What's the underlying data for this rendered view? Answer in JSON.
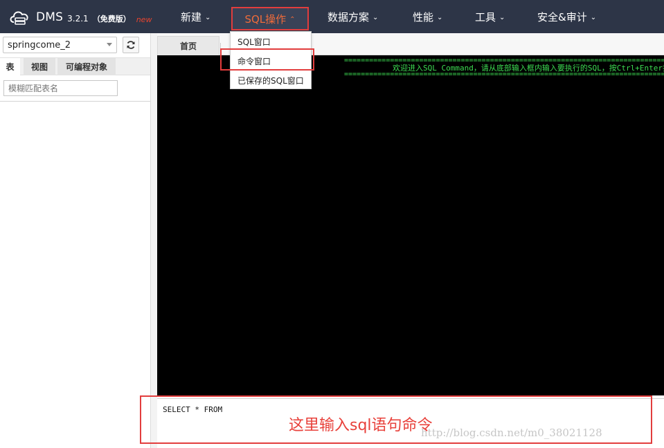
{
  "app": {
    "name": "DMS",
    "version": "3.2.1",
    "edition": "（免费版）",
    "badge": "new"
  },
  "nav": {
    "items": [
      {
        "label": "新建"
      },
      {
        "label": "SQL操作"
      },
      {
        "label": "数据方案"
      },
      {
        "label": "性能"
      },
      {
        "label": "工具"
      },
      {
        "label": "安全&审计"
      }
    ],
    "active_index": 1
  },
  "sql_menu": {
    "items": [
      {
        "label": "SQL窗口"
      },
      {
        "label": "命令窗口"
      },
      {
        "label": "已保存的SQL窗口"
      }
    ],
    "highlighted_index": 1
  },
  "sidebar": {
    "database": "springcome_2",
    "tabs": [
      {
        "label": "表"
      },
      {
        "label": "视图"
      },
      {
        "label": "可编程对象"
      }
    ],
    "active_tab": 0,
    "filter_placeholder": "模糊匹配表名"
  },
  "workspace": {
    "home_tab": "首页",
    "console": {
      "separator": "================================================================================================",
      "welcome": "欢迎进入SQL Command，请从底部输入框内输入要执行的SQL，按Ctrl+Enter执行"
    },
    "sql_input": "SELECT * FROM"
  },
  "annotation": "这里输入sql语句命令",
  "watermark": "http://blog.csdn.net/m0_38021128",
  "colors": {
    "topbar": "#2d3547",
    "accent": "#f06b3a",
    "highlight": "#e23d3d",
    "console_bg": "#000000",
    "console_text": "#3ddc52"
  }
}
